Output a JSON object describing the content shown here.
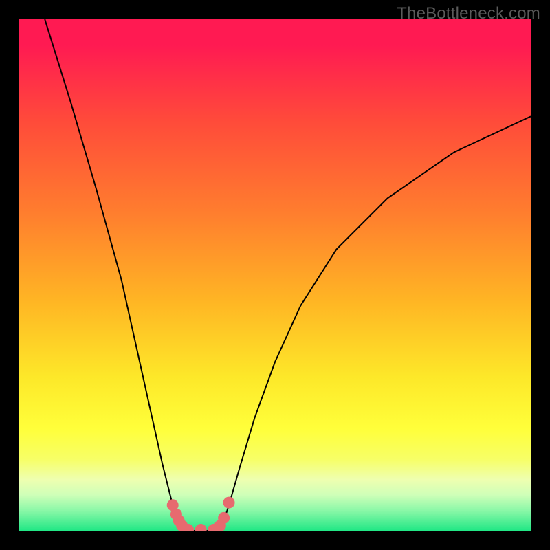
{
  "watermark": "TheBottleneck.com",
  "chart_data": {
    "type": "line",
    "title": "",
    "xlabel": "",
    "ylabel": "",
    "xlim": [
      0,
      100
    ],
    "ylim": [
      0,
      100
    ],
    "curve_left": {
      "x": [
        5,
        10,
        15,
        20,
        24,
        26,
        28,
        30,
        31,
        32,
        33
      ],
      "y": [
        100,
        84,
        67,
        49,
        31,
        22,
        13,
        5,
        2,
        0.2,
        0
      ]
    },
    "curve_right": {
      "x": [
        38,
        39,
        40,
        41,
        43,
        46,
        50,
        55,
        62,
        72,
        85,
        100
      ],
      "y": [
        0,
        0.3,
        2,
        5,
        12,
        22,
        33,
        44,
        55,
        65,
        74,
        81
      ]
    },
    "flat_segment": {
      "x": [
        33,
        38
      ],
      "y": [
        0,
        0
      ]
    },
    "markers": [
      {
        "x": 30.0,
        "y": 5.0
      },
      {
        "x": 30.7,
        "y": 3.2
      },
      {
        "x": 31.2,
        "y": 2.0
      },
      {
        "x": 31.8,
        "y": 1.0
      },
      {
        "x": 33.0,
        "y": 0.2
      },
      {
        "x": 35.5,
        "y": 0.2
      },
      {
        "x": 38.0,
        "y": 0.2
      },
      {
        "x": 39.3,
        "y": 1.0
      },
      {
        "x": 40.0,
        "y": 2.5
      },
      {
        "x": 41.0,
        "y": 5.5
      }
    ],
    "gradient_stops": [
      {
        "offset": 0.0,
        "color": "#ff1a52"
      },
      {
        "offset": 0.05,
        "color": "#ff1a52"
      },
      {
        "offset": 0.2,
        "color": "#ff4b3a"
      },
      {
        "offset": 0.38,
        "color": "#ff7e2e"
      },
      {
        "offset": 0.55,
        "color": "#ffb524"
      },
      {
        "offset": 0.7,
        "color": "#fde829"
      },
      {
        "offset": 0.8,
        "color": "#ffff3a"
      },
      {
        "offset": 0.86,
        "color": "#f7ff66"
      },
      {
        "offset": 0.9,
        "color": "#eeffb0"
      },
      {
        "offset": 0.93,
        "color": "#cfffb8"
      },
      {
        "offset": 0.96,
        "color": "#8cf8a8"
      },
      {
        "offset": 1.0,
        "color": "#20e785"
      }
    ],
    "marker_color": "#e76a6f",
    "line_color": "#000000"
  }
}
